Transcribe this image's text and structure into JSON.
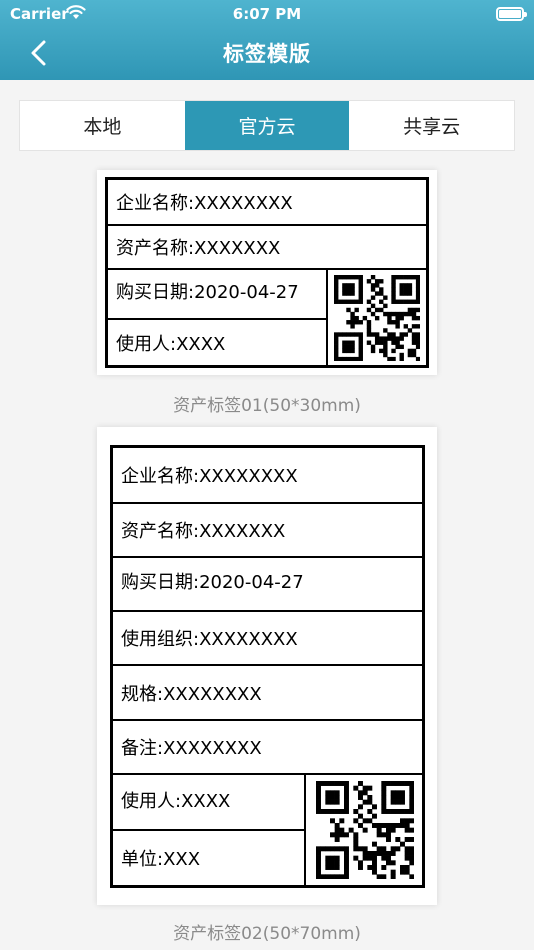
{
  "status_bar": {
    "carrier": "Carrier",
    "time": "6:07 PM"
  },
  "nav": {
    "title": "标签模版",
    "back_icon": "chevron-left-icon"
  },
  "tabs": [
    {
      "label": "本地",
      "active": false
    },
    {
      "label": "官方云",
      "active": true
    },
    {
      "label": "共享云",
      "active": false
    }
  ],
  "colors": {
    "accent": "#2d98b5",
    "caption": "#8a8a8a"
  },
  "templates": [
    {
      "caption": "资产标签01(50*30mm)",
      "rows": [
        "企业名称:XXXXXXXX",
        "资产名称:XXXXXXX",
        "购买日期:2020-04-27",
        "使用人:XXXX"
      ]
    },
    {
      "caption": "资产标签02(50*70mm)",
      "rows": [
        "企业名称:XXXXXXXX",
        "资产名称:XXXXXXX",
        "购买日期:2020-04-27",
        "使用组织:XXXXXXXX",
        "规格:XXXXXXXX",
        "备注:XXXXXXXX",
        "使用人:XXXX",
        "单位:XXX"
      ]
    }
  ]
}
